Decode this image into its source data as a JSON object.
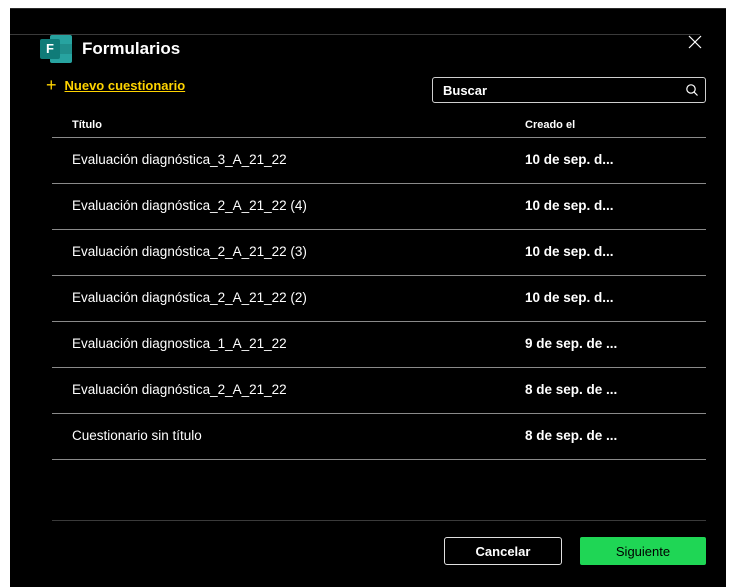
{
  "dialog": {
    "title": "Formularios",
    "app_icon_letter": "F",
    "icon": "microsoft-forms-icon",
    "close_icon": "close-icon"
  },
  "toolbar": {
    "new_plus": "+",
    "new_label": "Nuevo cuestionario"
  },
  "search": {
    "placeholder": "Buscar",
    "value": "",
    "icon": "search-icon"
  },
  "table": {
    "columns": [
      "Título",
      "Creado el"
    ],
    "rows": [
      {
        "title": "Evaluación diagnóstica_3_A_21_22",
        "created": "10 de sep. d..."
      },
      {
        "title": "Evaluación diagnóstica_2_A_21_22 (4)",
        "created": "10 de sep. d..."
      },
      {
        "title": "Evaluación diagnóstica_2_A_21_22 (3)",
        "created": "10 de sep. d..."
      },
      {
        "title": "Evaluación diagnóstica_2_A_21_22 (2)",
        "created": "10 de sep. d..."
      },
      {
        "title": "Evaluación diagnostica_1_A_21_22",
        "created": "9 de sep. de ..."
      },
      {
        "title": "Evaluación diagnóstica_2_A_21_22",
        "created": "8 de sep. de ..."
      },
      {
        "title": "Cuestionario sin título",
        "created": "8 de sep. de ..."
      }
    ]
  },
  "footer": {
    "cancel_label": "Cancelar",
    "next_label": "Siguiente"
  },
  "colors": {
    "background": "#000000",
    "accent_link": "#ffd400",
    "primary_button": "#1fd655",
    "forms_teal": "#0f7b78"
  }
}
